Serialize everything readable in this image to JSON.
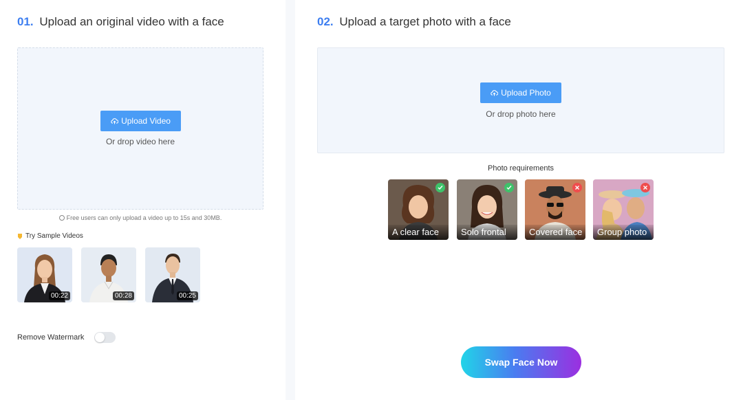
{
  "left": {
    "step_number": "01.",
    "step_title": "Upload an original video with a face",
    "upload_button": "Upload Video",
    "drop_hint": "Or drop video here",
    "free_note": "Free users can only upload a video up to 15s and 30MB.",
    "samples_title": "Try Sample Videos",
    "samples": [
      {
        "duration": "00:22"
      },
      {
        "duration": "00:28"
      },
      {
        "duration": "00:25"
      }
    ],
    "watermark_label": "Remove Watermark",
    "watermark_enabled": false
  },
  "right": {
    "step_number": "02.",
    "step_title": "Upload a target photo with a face",
    "upload_button": "Upload Photo",
    "drop_hint": "Or drop photo here",
    "requirements_title": "Photo requirements",
    "requirements": [
      {
        "label": "A clear face",
        "status": "ok"
      },
      {
        "label": "Solo frontal",
        "status": "ok"
      },
      {
        "label": "Covered face",
        "status": "bad"
      },
      {
        "label": "Group photo",
        "status": "bad"
      }
    ],
    "swap_button": "Swap Face Now"
  },
  "colors": {
    "accent": "#3d7ef0",
    "button": "#4a9cf6",
    "ok": "#3ec26a",
    "bad": "#ef4d4d"
  }
}
